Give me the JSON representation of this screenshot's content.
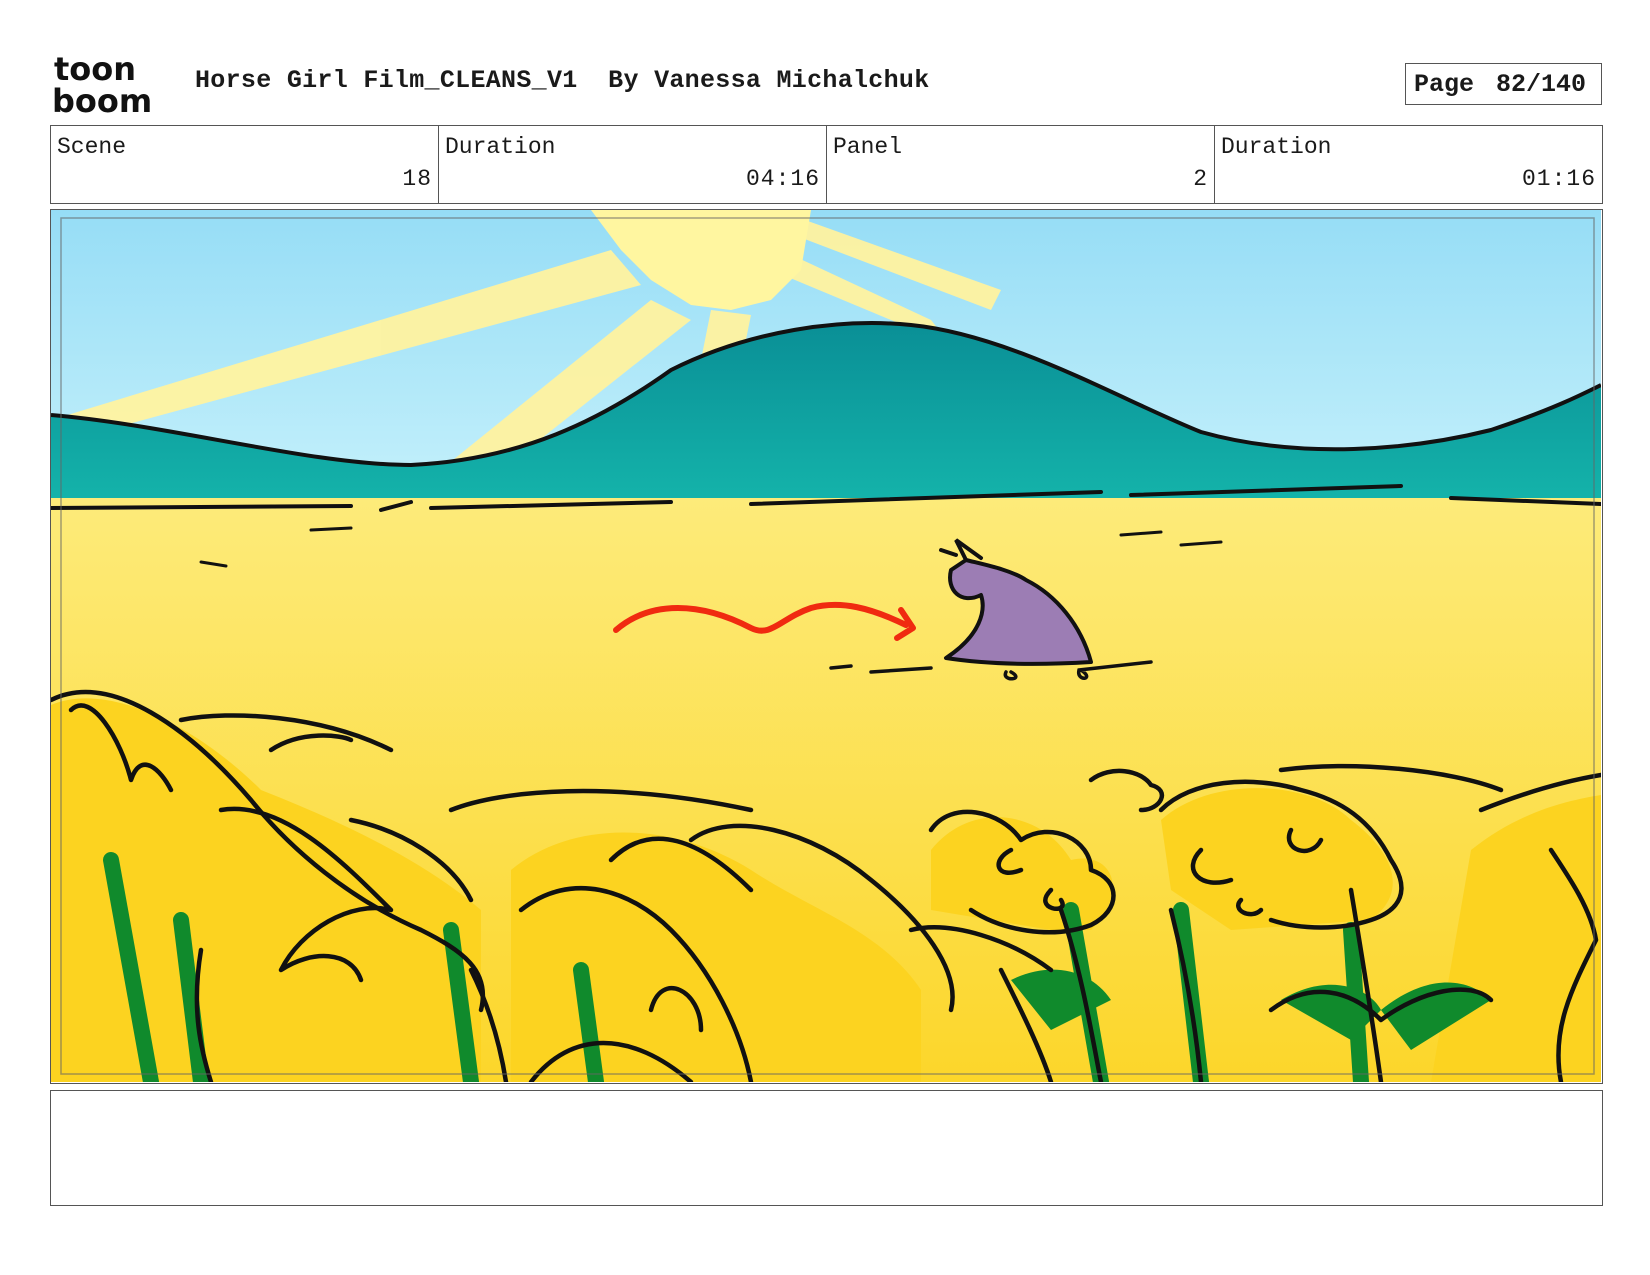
{
  "header": {
    "logo_text_top": "toon",
    "logo_text_bottom": "boom",
    "title": "Horse Girl Film_CLEANS_V1  By Vanessa Michalchuk",
    "page_label": "Page",
    "page_value": "82/140"
  },
  "info": {
    "scene_label": "Scene",
    "scene_value": "18",
    "scene_duration_label": "Duration",
    "scene_duration_value": "04:16",
    "panel_label": "Panel",
    "panel_value": "2",
    "panel_duration_label": "Duration",
    "panel_duration_value": "01:16"
  },
  "notes": {
    "text": ""
  },
  "colors": {
    "sky": "#a6e3f7",
    "sun": "#fff6a0",
    "hills": "#0d9a9a",
    "field": "#fde467",
    "flowers": "#fcd320",
    "stems": "#108a2c",
    "horse": "#9c7db4",
    "arrow": "#f02a10"
  }
}
